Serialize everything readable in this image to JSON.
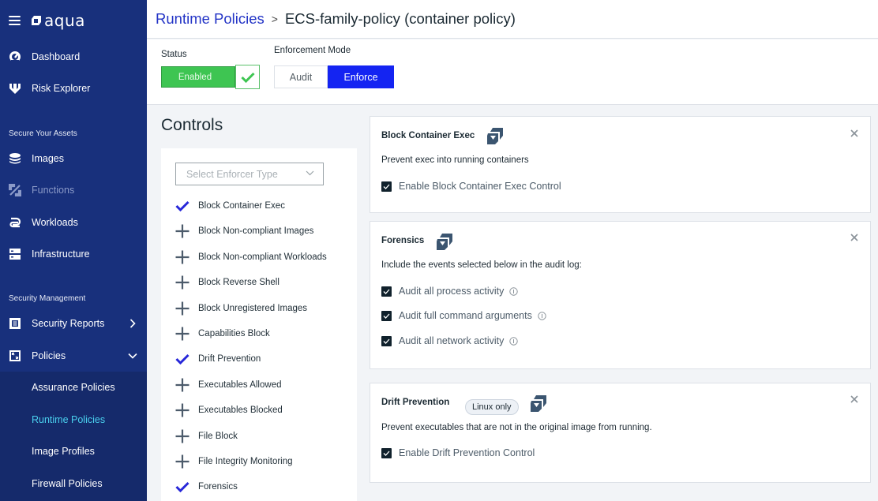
{
  "app": {
    "logo_text": "aqua"
  },
  "sidebar": {
    "top_items": [
      {
        "label": "Dashboard",
        "icon": "dashboard-gauge-icon"
      },
      {
        "label": "Risk Explorer",
        "icon": "risk-explorer-icon"
      }
    ],
    "sections": [
      {
        "title": "Secure Your Assets",
        "items": [
          {
            "label": "Images",
            "icon": "images-stack-icon"
          },
          {
            "label": "Functions",
            "icon": "functions-icon",
            "disabled": true
          },
          {
            "label": "Workloads",
            "icon": "workloads-icon"
          },
          {
            "label": "Infrastructure",
            "icon": "infrastructure-icon"
          }
        ]
      },
      {
        "title": "Security Management",
        "items": [
          {
            "label": "Security Reports",
            "icon": "security-reports-icon",
            "chevron": "right"
          },
          {
            "label": "Policies",
            "icon": "policies-icon",
            "chevron": "down",
            "expanded": true
          }
        ]
      }
    ],
    "policies_sub": [
      {
        "label": "Assurance Policies",
        "active": false
      },
      {
        "label": "Runtime Policies",
        "active": true
      },
      {
        "label": "Image Profiles",
        "active": false
      },
      {
        "label": "Firewall Policies",
        "active": false
      }
    ]
  },
  "header": {
    "breadcrumb_parent": "Runtime Policies",
    "separator": ">",
    "breadcrumb_current": "ECS-family-policy (container policy)"
  },
  "status": {
    "label": "Status",
    "value": "Enabled",
    "enabled": true
  },
  "enforcement": {
    "label": "Enforcement Mode",
    "options": [
      "Audit",
      "Enforce"
    ],
    "selected": "Enforce"
  },
  "controls": {
    "title": "Controls",
    "select_placeholder": "Select Enforcer Type",
    "items": [
      {
        "label": "Block Container Exec",
        "selected": true
      },
      {
        "label": "Block Non-compliant Images",
        "selected": false
      },
      {
        "label": "Block Non-compliant Workloads",
        "selected": false
      },
      {
        "label": "Block Reverse Shell",
        "selected": false
      },
      {
        "label": "Block Unregistered Images",
        "selected": false
      },
      {
        "label": "Capabilities Block",
        "selected": false
      },
      {
        "label": "Drift Prevention",
        "selected": true
      },
      {
        "label": "Executables Allowed",
        "selected": false
      },
      {
        "label": "Executables Blocked",
        "selected": false
      },
      {
        "label": "File Block",
        "selected": false
      },
      {
        "label": "File Integrity Monitoring",
        "selected": false
      },
      {
        "label": "Forensics",
        "selected": true
      }
    ]
  },
  "cards": [
    {
      "title": "Block Container Exec",
      "description": "Prevent exec into running containers",
      "checkboxes": [
        {
          "label": "Enable Block Container Exec Control",
          "checked": true,
          "info": false
        }
      ]
    },
    {
      "title": "Forensics",
      "description": "Include the events selected below in the audit log:",
      "checkboxes": [
        {
          "label": "Audit all process activity",
          "checked": true,
          "info": true
        },
        {
          "label": "Audit full command arguments",
          "checked": true,
          "info": true
        },
        {
          "label": "Audit all network activity",
          "checked": true,
          "info": true
        }
      ]
    },
    {
      "title": "Drift Prevention",
      "badge": "Linux only",
      "description": "Prevent executables that are not in the original image from running.",
      "checkboxes": [
        {
          "label": "Enable Drift Prevention Control",
          "checked": true,
          "info": false
        }
      ]
    }
  ],
  "colors": {
    "sidebar_bg": "#18307c",
    "sidebar_sub_bg": "#152a6b",
    "active_link": "#4ad0ee",
    "breadcrumb_link": "#2334c6",
    "enabled_green": "#3ec552",
    "enforce_blue": "#1424f2",
    "check_blue": "#2727d9"
  }
}
